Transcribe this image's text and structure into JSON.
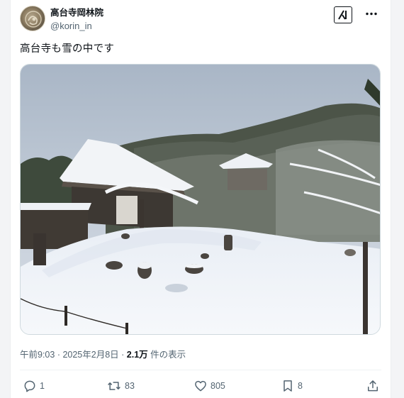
{
  "post": {
    "author": {
      "display_name": "高台寺岡林院",
      "handle": "@korin_in"
    },
    "text": "高台寺も雪の中です",
    "meta": {
      "time": "午前9:03",
      "separator1": " · ",
      "date": "2025年2月8日",
      "separator2": " · ",
      "views_count": "2.1万",
      "views_label": " 件の表示"
    },
    "actions": {
      "replies": "1",
      "reposts": "83",
      "likes": "805",
      "bookmarks": "8"
    }
  },
  "icons": {
    "avatar": "temple-crest-avatar",
    "grok": "grok-icon",
    "more": "more-dots-icon",
    "reply": "reply-bubble-icon",
    "repost": "repost-icon",
    "like": "heart-icon",
    "bookmark": "bookmark-icon",
    "share": "share-icon"
  },
  "colors": {
    "text_primary": "#0f1419",
    "text_secondary": "#536471",
    "border": "#cfd9de"
  }
}
